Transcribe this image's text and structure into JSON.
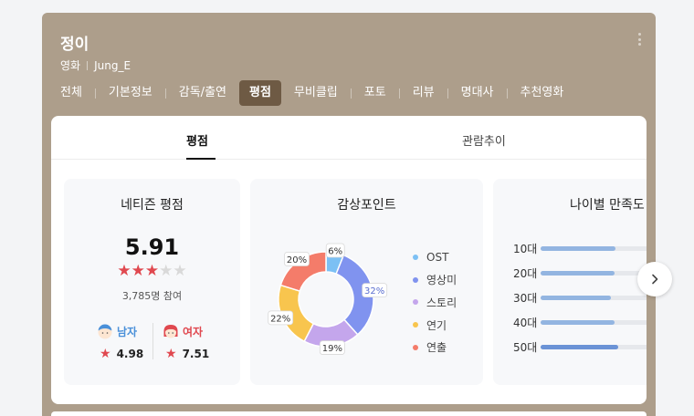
{
  "header": {
    "title": "정이",
    "category": "영화",
    "subtitle": "Jung_E"
  },
  "tabs": [
    {
      "label": "전체",
      "active": false
    },
    {
      "label": "기본정보",
      "active": false
    },
    {
      "label": "감독/출연",
      "active": false
    },
    {
      "label": "평점",
      "active": true
    },
    {
      "label": "무비클립",
      "active": false
    },
    {
      "label": "포토",
      "active": false
    },
    {
      "label": "리뷰",
      "active": false
    },
    {
      "label": "명대사",
      "active": false
    },
    {
      "label": "추천영화",
      "active": false
    }
  ],
  "subtabs": {
    "rating": "평점",
    "trend": "관람추이"
  },
  "netizen": {
    "title": "네티즌 평점",
    "score": "5.91",
    "stars_filled": 3,
    "stars_total": 5,
    "participants": "3,785명 참여",
    "male_label": "남자",
    "male_score": "4.98",
    "female_label": "여자",
    "female_score": "7.51"
  },
  "points": {
    "title": "감상포인트",
    "segments": [
      {
        "label": "OST",
        "value": 6,
        "pct_label": "6%",
        "color": "#7cc0f4"
      },
      {
        "label": "영상미",
        "value": 32,
        "pct_label": "32%",
        "color": "#8093ef"
      },
      {
        "label": "스토리",
        "value": 19,
        "pct_label": "19%",
        "color": "#c4a6ec"
      },
      {
        "label": "연기",
        "value": 22,
        "pct_label": "22%",
        "color": "#f8c54e"
      },
      {
        "label": "연출",
        "value": 20,
        "pct_label": "20%",
        "color": "#f47c6a"
      }
    ]
  },
  "age": {
    "title": "나이별 만족도",
    "rows": [
      {
        "label": "10대",
        "level": 0.63,
        "color": "#93b5e1"
      },
      {
        "label": "20대",
        "level": 0.62,
        "color": "#93b5e1"
      },
      {
        "label": "30대",
        "level": 0.59,
        "color": "#93b5e1"
      },
      {
        "label": "40대",
        "level": 0.62,
        "color": "#93b5e1"
      },
      {
        "label": "50대",
        "level": 0.65,
        "color": "#6b93d6"
      }
    ]
  },
  "colors": {
    "header_bg": "#ad9e8b",
    "active_tab": "#6e5a44",
    "star": "#e0484f",
    "male": "#4a90d9",
    "female": "#e0484f"
  }
}
